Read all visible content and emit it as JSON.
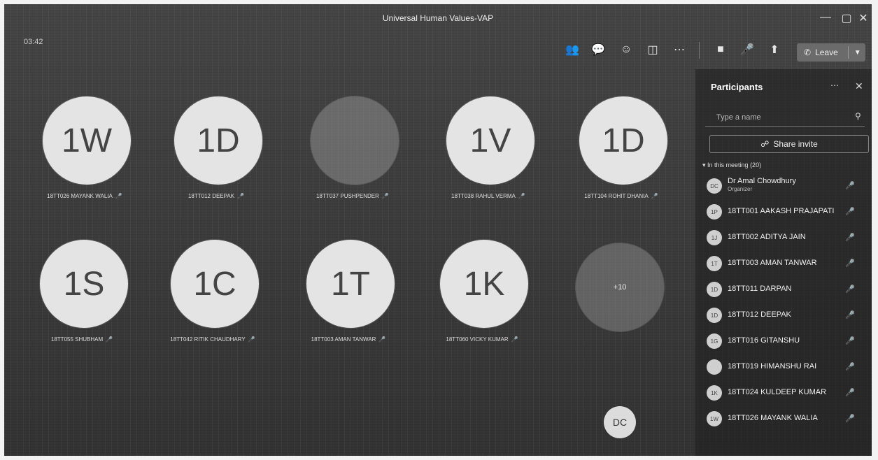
{
  "window": {
    "title": "Universal Human Values-VAP",
    "timer": "03:42"
  },
  "toolbar": {
    "icons": [
      "people-icon",
      "chat-icon",
      "reactions-icon",
      "view-icon",
      "more-icon",
      "camera-off-icon",
      "mic-off-icon",
      "share-screen-icon"
    ],
    "leave_label": "Leave"
  },
  "tiles": [
    {
      "initials": "1W",
      "name": "18TT026 MAYANK WALIA"
    },
    {
      "initials": "1D",
      "name": "18TT012 DEEPAK"
    },
    {
      "initials": "",
      "name": "18TT037 PUSHPENDER"
    },
    {
      "initials": "1V",
      "name": "18TT038 RAHUL VERMA"
    },
    {
      "initials": "1D",
      "name": "18TT104 ROHIT DHANIA"
    },
    {
      "initials": "1S",
      "name": "18TT055 SHUBHAM"
    },
    {
      "initials": "1C",
      "name": "18TT042 RITIK CHAUDHARY"
    },
    {
      "initials": "1T",
      "name": "18TT003 AMAN TANWAR"
    },
    {
      "initials": "1K",
      "name": "18TT060 VICKY KUMAR"
    },
    {
      "initials": "+10",
      "name": ""
    }
  ],
  "self_avatar": "DC",
  "participants_panel": {
    "title": "Participants",
    "search_placeholder": "Type a name",
    "share_invite_label": "Share invite",
    "section_label": "In this meeting (20)",
    "items": [
      {
        "initials": "DC",
        "name": "Dr Amal Chowdhury",
        "role": "Organizer"
      },
      {
        "initials": "1P",
        "name": "18TT001 AAKASH PRAJAPATI",
        "role": ""
      },
      {
        "initials": "1J",
        "name": "18TT002 ADITYA JAIN",
        "role": ""
      },
      {
        "initials": "1T",
        "name": "18TT003 AMAN TANWAR",
        "role": ""
      },
      {
        "initials": "1D",
        "name": "18TT011 DARPAN",
        "role": ""
      },
      {
        "initials": "1D",
        "name": "18TT012 DEEPAK",
        "role": ""
      },
      {
        "initials": "1G",
        "name": "18TT016 GITANSHU",
        "role": ""
      },
      {
        "initials": "",
        "name": "18TT019 HIMANSHU RAI",
        "role": ""
      },
      {
        "initials": "1K",
        "name": "18TT024 KULDEEP KUMAR",
        "role": ""
      },
      {
        "initials": "1W",
        "name": "18TT026 MAYANK WALIA",
        "role": ""
      }
    ]
  }
}
